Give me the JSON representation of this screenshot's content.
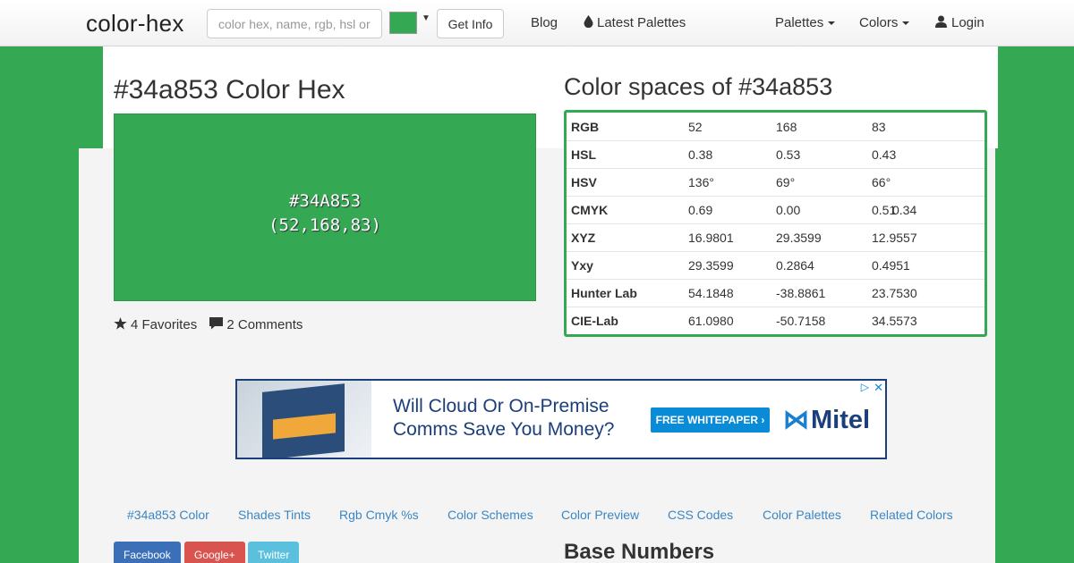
{
  "navbar": {
    "brand": "color-hex",
    "search_placeholder": "color hex, name, rgb, hsl or",
    "get_info_label": "Get Info",
    "blog_label": "Blog",
    "latest_palettes_label": "Latest Palettes",
    "palettes_label": "Palettes",
    "colors_label": "Colors",
    "login_label": "Login",
    "swatch_color": "#34a853"
  },
  "color": {
    "title": "#34a853 Color Hex",
    "block_hex": "#34A853",
    "block_rgb": "(52,168,83)",
    "favorites": "4 Favorites",
    "comments": "2 Comments"
  },
  "color_spaces": {
    "title": "Color spaces of #34a853",
    "rows": [
      {
        "name": "RGB",
        "v1": "52",
        "v2": "168",
        "v3": "83",
        "v4": ""
      },
      {
        "name": "HSL",
        "v1": "0.38",
        "v2": "0.53",
        "v3": "0.43",
        "v4": ""
      },
      {
        "name": "HSV",
        "v1": "136°",
        "v2": "69°",
        "v3": "66°",
        "v4": ""
      },
      {
        "name": "CMYK",
        "v1": "0.69",
        "v2": "0.00",
        "v3": "0.51",
        "v4": "0.34"
      },
      {
        "name": "XYZ",
        "v1": "16.9801",
        "v2": "29.3599",
        "v3": "12.9557",
        "v4": ""
      },
      {
        "name": "Yxy",
        "v1": "29.3599",
        "v2": "0.2864",
        "v3": "0.4951",
        "v4": ""
      },
      {
        "name": "Hunter Lab",
        "v1": "54.1848",
        "v2": "-38.8861",
        "v3": "23.7530",
        "v4": ""
      },
      {
        "name": "CIE-Lab",
        "v1": "61.0980",
        "v2": "-50.7158",
        "v3": "34.5573",
        "v4": ""
      }
    ]
  },
  "ad": {
    "headline": "Will Cloud Or On-Premise Comms Save You Money?",
    "cta": "FREE WHITEPAPER ›",
    "logo": "Mitel"
  },
  "subnav": [
    "#34a853 Color",
    "Shades Tints",
    "Rgb Cmyk %s",
    "Color Schemes",
    "Color Preview",
    "CSS Codes",
    "Color Palettes",
    "Related Colors"
  ],
  "share": {
    "facebook": "Facebook",
    "google": "Google+",
    "twitter": "Twitter"
  },
  "base_numbers_title": "Base Numbers",
  "colors": {
    "primary": "#34a853",
    "link": "#3b86c4"
  }
}
